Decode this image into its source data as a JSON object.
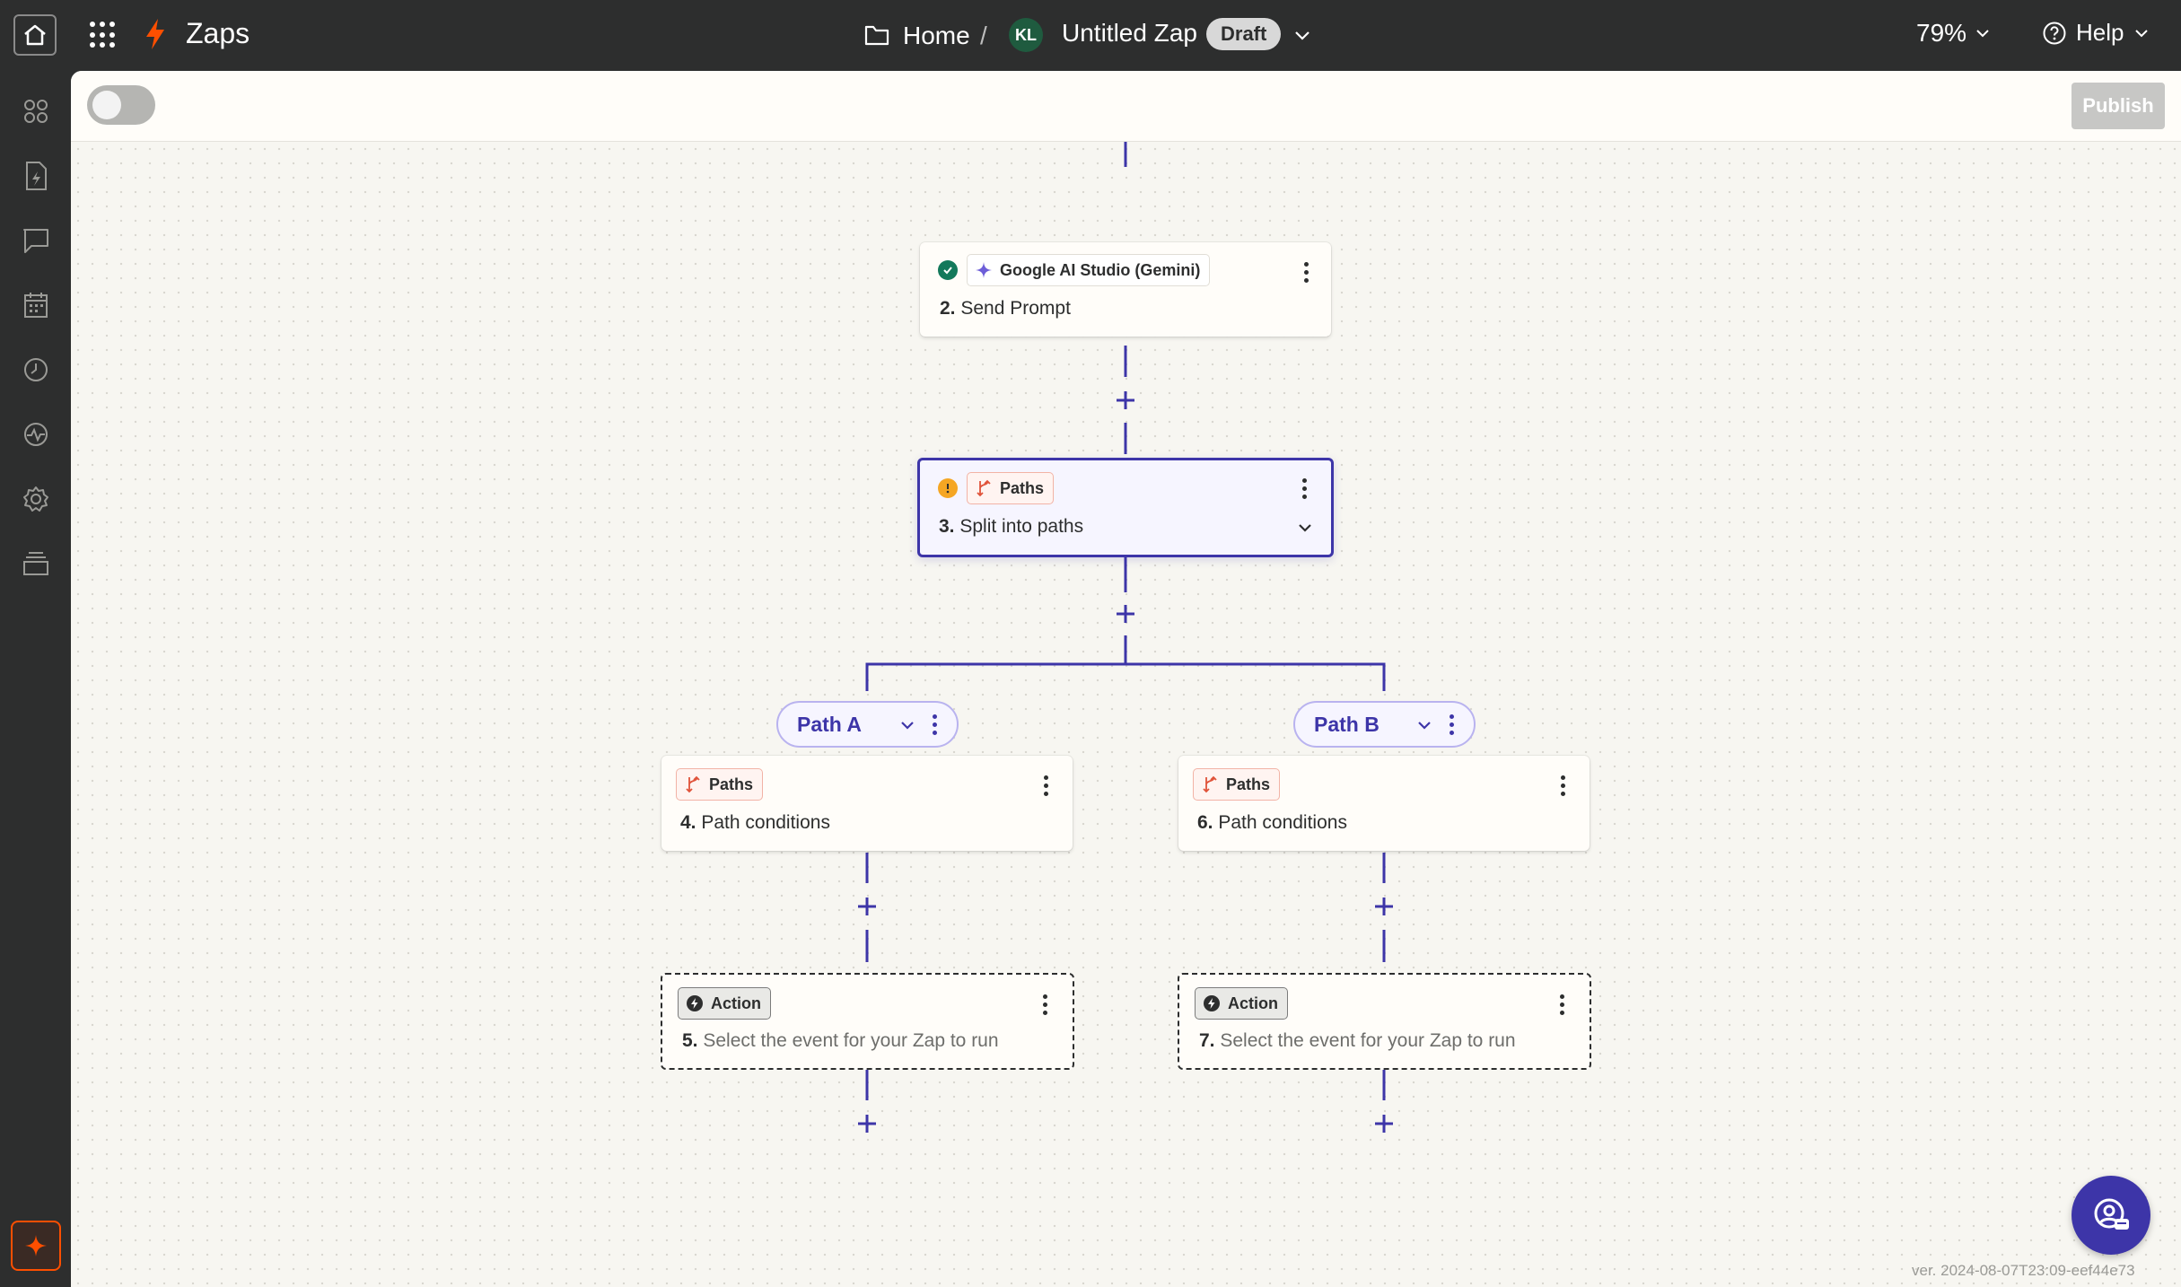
{
  "header": {
    "app_title": "Zaps",
    "breadcrumb_home": "Home",
    "breadcrumb_separator": "/",
    "avatar_initials": "KL",
    "zap_name": "Untitled Zap",
    "status_badge": "Draft",
    "zoom_level": "79%",
    "help_label": "Help"
  },
  "toolbar": {
    "publish_label": "Publish",
    "zap_enabled": false
  },
  "sidebar": {
    "items": [
      {
        "icon": "apps-grid-icon"
      },
      {
        "icon": "zap-file-icon"
      },
      {
        "icon": "chat-icon"
      },
      {
        "icon": "calendar-icon"
      },
      {
        "icon": "history-icon"
      },
      {
        "icon": "activity-icon"
      },
      {
        "icon": "settings-icon"
      },
      {
        "icon": "archive-icon"
      }
    ],
    "ai_button_icon": "sparkle-icon"
  },
  "steps": {
    "step2": {
      "app": "Google AI Studio (Gemini)",
      "number": "2.",
      "title": "Send Prompt",
      "status": "complete"
    },
    "step3": {
      "app": "Paths",
      "number": "3.",
      "title": "Split into paths",
      "status": "warning"
    },
    "step4": {
      "app": "Paths",
      "number": "4.",
      "title": "Path conditions"
    },
    "step5": {
      "app": "Action",
      "number": "5.",
      "title": "Select the event for your Zap to run"
    },
    "step6": {
      "app": "Paths",
      "number": "6.",
      "title": "Path conditions"
    },
    "step7": {
      "app": "Action",
      "number": "7.",
      "title": "Select the event for your Zap to run"
    }
  },
  "paths": {
    "a": {
      "label": "Path A"
    },
    "b": {
      "label": "Path B"
    }
  },
  "footer": {
    "version": "ver. 2024-08-07T23:09-eef44e73"
  },
  "colors": {
    "accent": "#3d35a8",
    "brand_orange": "#ff4f00",
    "topbar": "#2d2e2e",
    "canvas": "#f7f6f1",
    "success": "#13795b",
    "warning": "#f5a623"
  }
}
